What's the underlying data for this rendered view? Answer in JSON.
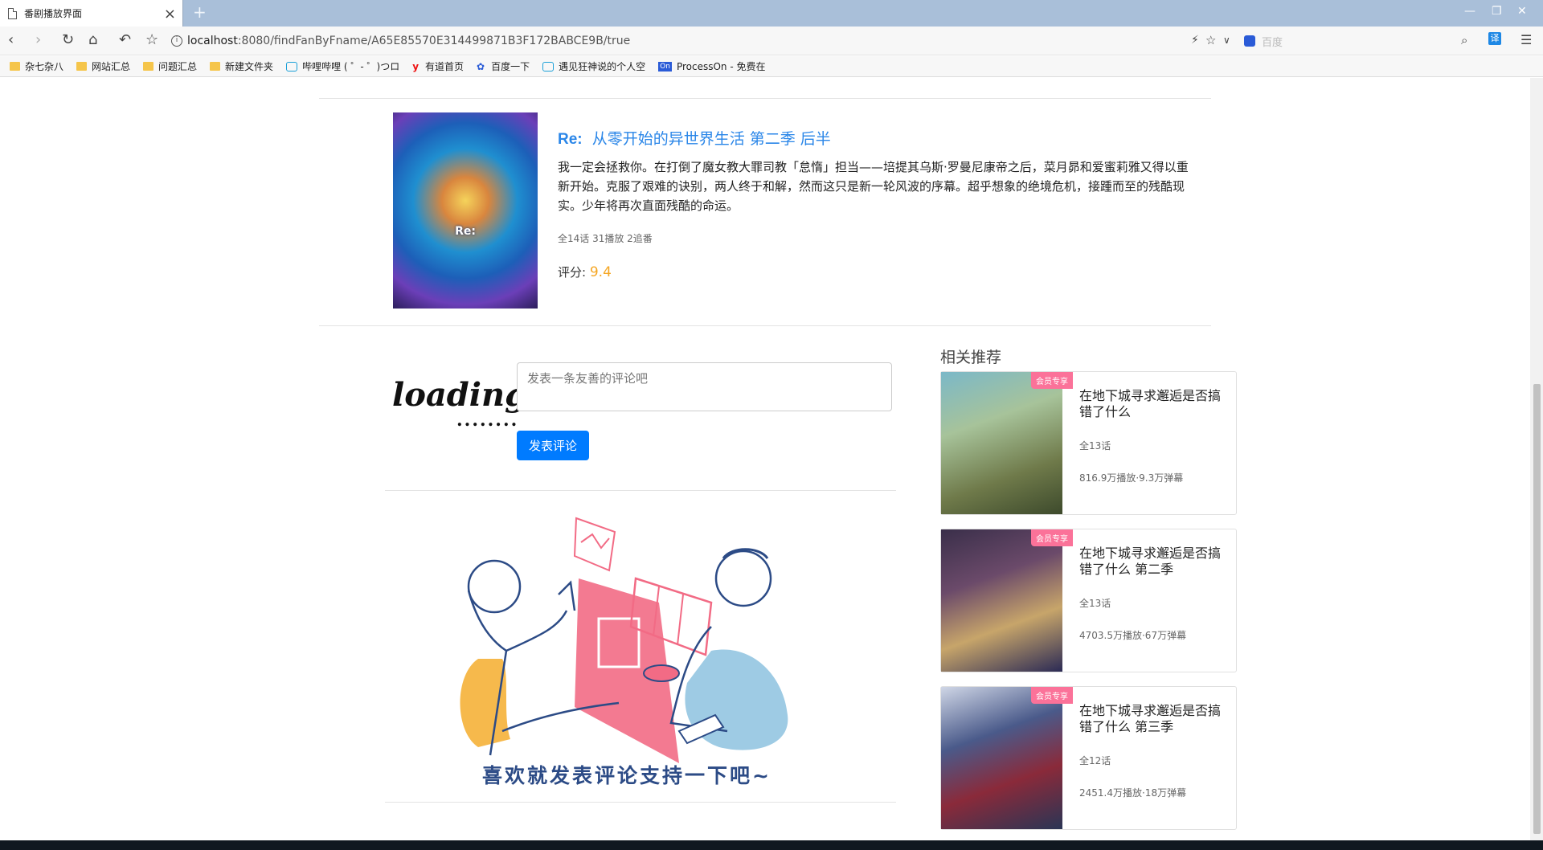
{
  "browser": {
    "tab_title": "番剧播放界面",
    "url_host": "localhost",
    "url_path": ":8080/findFanByFname/A65E85570E314499871B3F172BABCE9B/true",
    "search_placeholder": "百度",
    "translate_label": "译",
    "bookmarks": [
      {
        "label": "杂七杂八",
        "icon": "folder-icon"
      },
      {
        "label": "网站汇总",
        "icon": "folder-icon"
      },
      {
        "label": "问题汇总",
        "icon": "folder-icon"
      },
      {
        "label": "新建文件夹",
        "icon": "folder-icon"
      },
      {
        "label": "哔哩哔哩 ( ゜- ゜)つロ",
        "icon": "bilibili-icon"
      },
      {
        "label": "有道首页",
        "icon": "youdao-icon"
      },
      {
        "label": "百度一下",
        "icon": "baidu-icon"
      },
      {
        "label": "遇见狂神说的个人空",
        "icon": "bilibili-icon"
      },
      {
        "label": "ProcessOn - 免费在",
        "icon": "processon-icon"
      }
    ]
  },
  "anime": {
    "title_prefix": "Re:",
    "title": "从零开始的异世界生活 第二季 后半",
    "description": "我一定会拯救你。在打倒了魔女教大罪司教「怠惰」担当——培提其乌斯·罗曼尼康帝之后，菜月昴和爱蜜莉雅又得以重新开始。克服了艰难的诀别，两人终于和解，然而这只是新一轮风波的序幕。超乎想象的绝境危机，接踵而至的残酷现实。少年将再次直面残酷的命运。",
    "meta": "全14话 31播放 2追番",
    "score_label": "评分:",
    "score_value": "9.4"
  },
  "comment": {
    "avatar_text": "loading",
    "avatar_dots": "........",
    "placeholder": "发表一条友善的评论吧",
    "submit_label": "发表评论",
    "illustration_caption": "喜欢就发表评论支持一下吧~"
  },
  "recommend": {
    "heading": "相关推荐",
    "items": [
      {
        "badge": "会员专享",
        "title": "在地下城寻求邂逅是否搞错了什么",
        "episodes": "全13话",
        "plays": "816.9万播放·9.3万弹幕"
      },
      {
        "badge": "会员专享",
        "title": "在地下城寻求邂逅是否搞错了什么 第二季",
        "episodes": "全13话",
        "plays": "4703.5万播放·67万弹幕"
      },
      {
        "badge": "会员专享",
        "title": "在地下城寻求邂逅是否搞错了什么 第三季",
        "episodes": "全12话",
        "plays": "2451.4万播放·18万弹幕"
      }
    ]
  },
  "colors": {
    "title_blue": "#2a86e8",
    "score_orange": "#f5a623",
    "button_blue": "#007bff",
    "vip_pink": "#fb7299"
  }
}
